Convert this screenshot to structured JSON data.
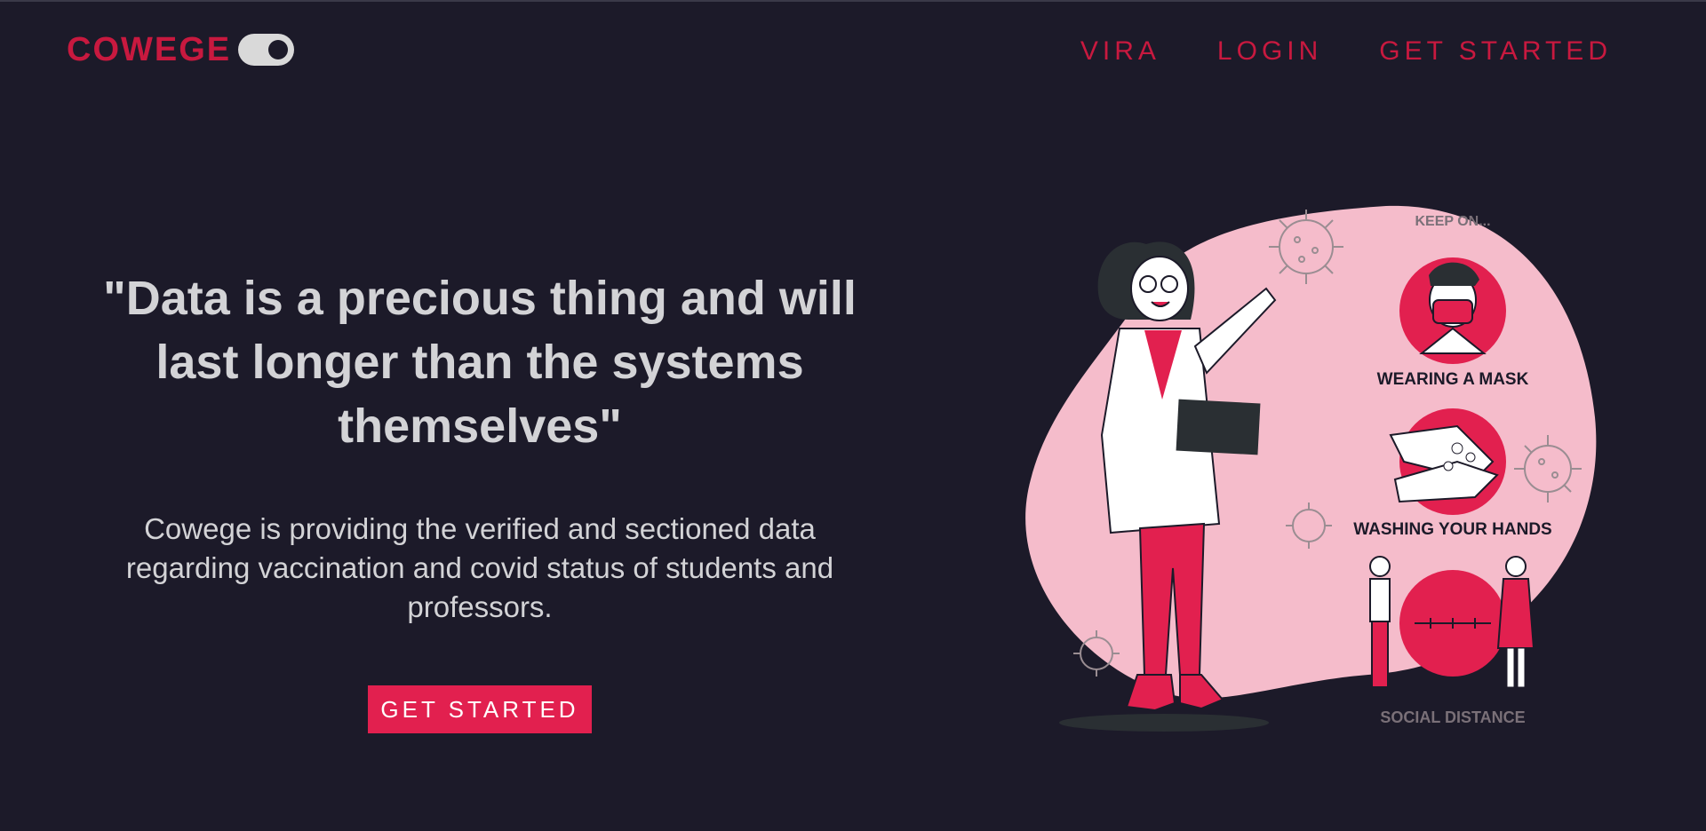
{
  "brand": {
    "name": "COWEGE",
    "accent": "#c8193f",
    "background": "#1c1a29"
  },
  "nav": {
    "items": [
      {
        "label": "VIRA"
      },
      {
        "label": "LOGIN"
      },
      {
        "label": "GET STARTED"
      }
    ]
  },
  "hero": {
    "quote": "\"Data is a precious thing and will last longer than the systems themselves\"",
    "description": "Cowege is providing the verified and sectioned data regarding vaccination and covid status of students and professors.",
    "cta_label": "GET STARTED",
    "cta_color": "#e2204f"
  },
  "illustration": {
    "keep_on": "KEEP ON...",
    "mask": "WEARING A MASK",
    "hands": "WASHING YOUR HANDS",
    "distance": "SOCIAL DISTANCE"
  }
}
